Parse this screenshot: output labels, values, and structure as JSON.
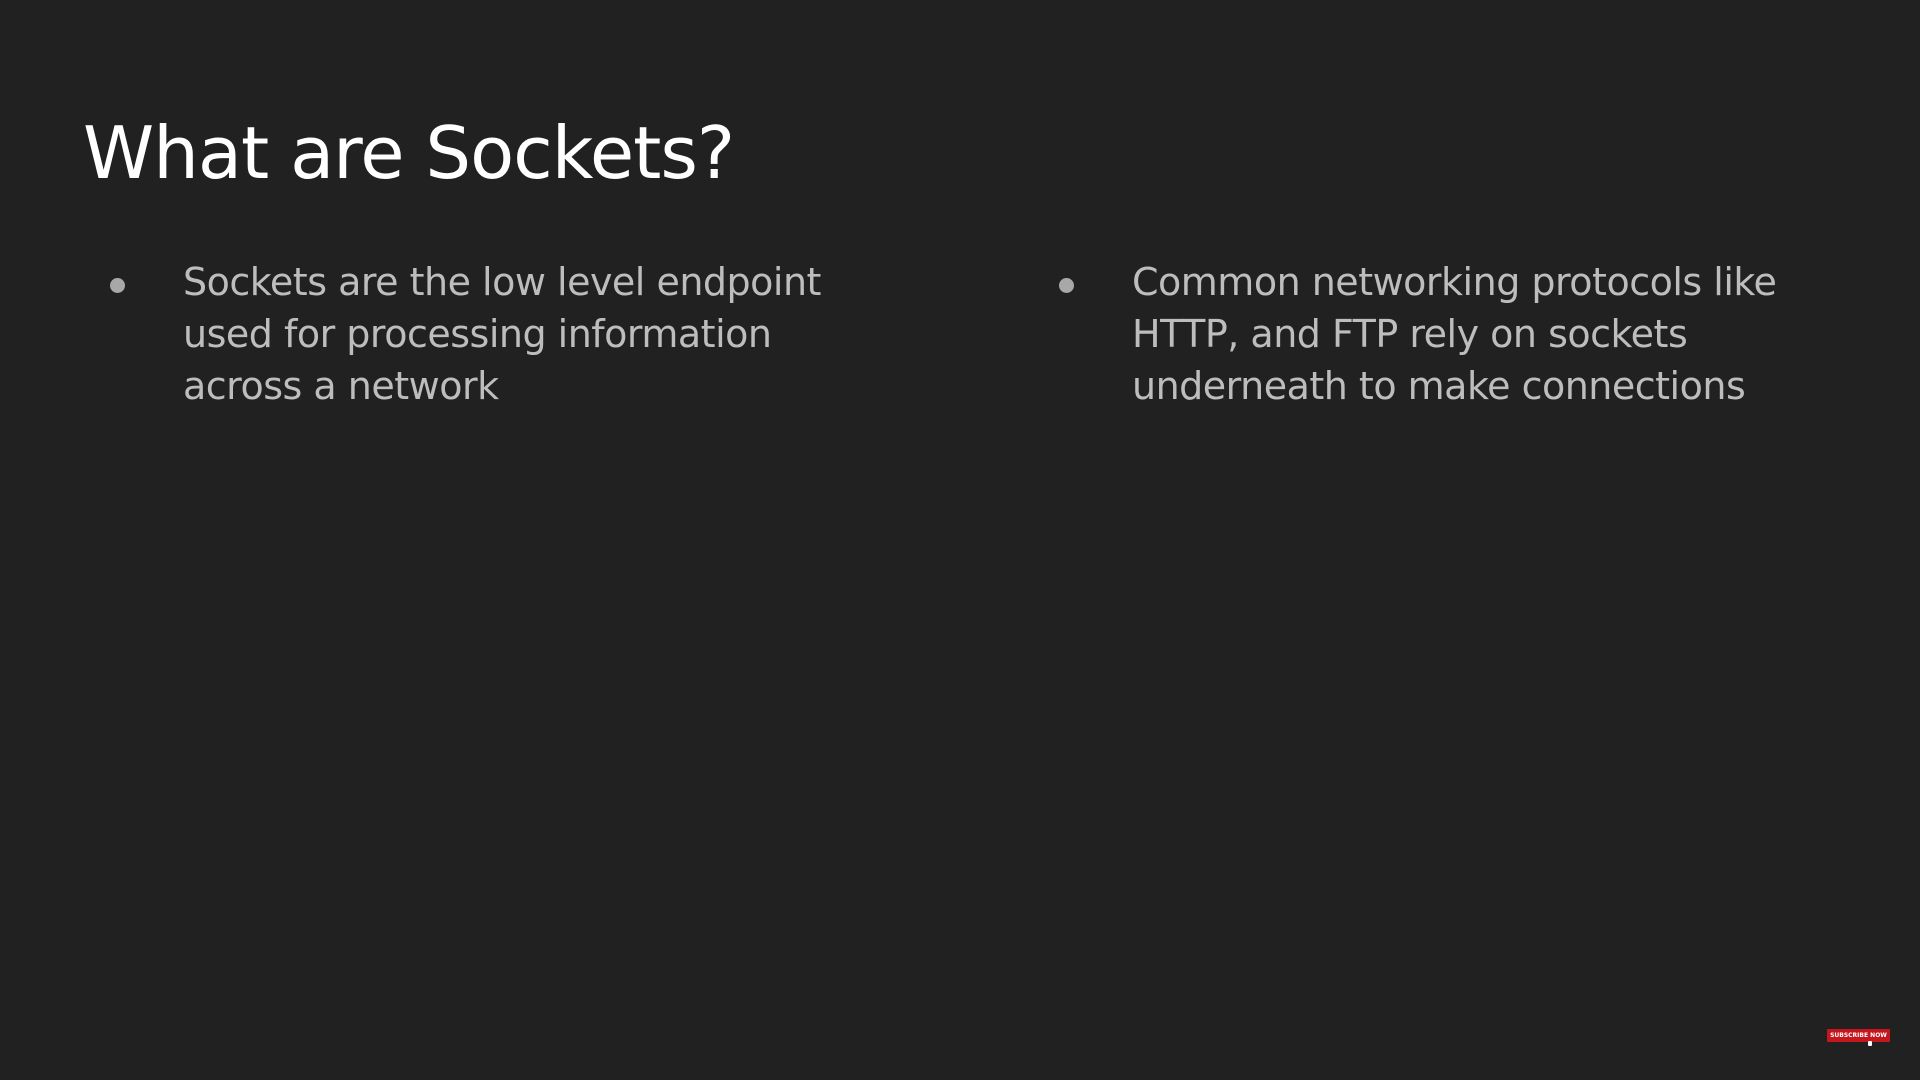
{
  "slide": {
    "title": "What are Sockets?",
    "bullets": [
      {
        "text": "Sockets are the low level endpoint used for processing information across a network"
      },
      {
        "text": "Common networking protocols like HTTP, and FTP rely on sockets underneath to make connections"
      }
    ]
  },
  "overlay": {
    "subscribe_label": "SUBSCRIBE NOW",
    "subscribe_color": "#c4161c"
  },
  "colors": {
    "background": "#212121",
    "title": "#ffffff",
    "body_text": "#bdbdbd",
    "bullet": "#a8a8a8"
  }
}
